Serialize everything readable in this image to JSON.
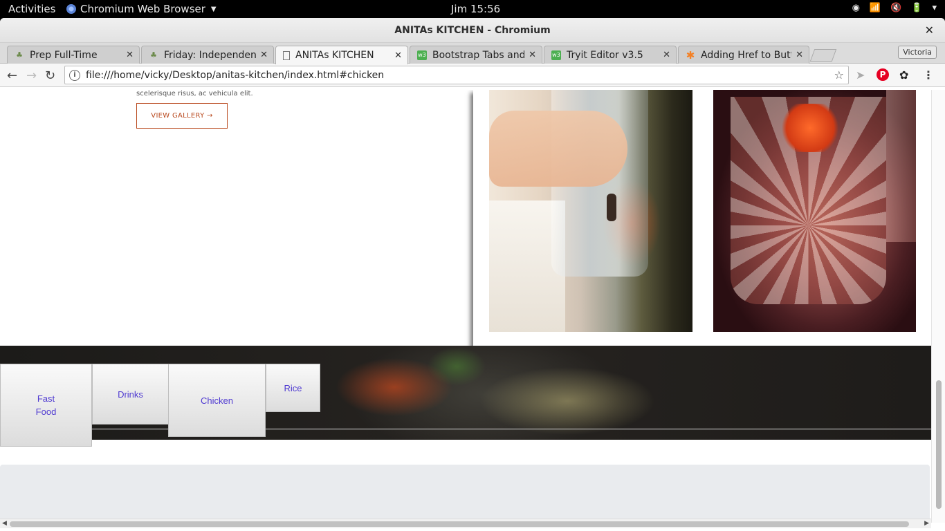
{
  "desktop": {
    "activities": "Activities",
    "app_menu": "Chromium Web Browser",
    "clock": "Jim 15:56"
  },
  "window": {
    "title": "ANITAs KITCHEN - Chromium",
    "close": "✕"
  },
  "tabs": [
    {
      "label": "Prep Full-Time",
      "icon": "tree-icon"
    },
    {
      "label": "Friday: Independent",
      "icon": "tree-icon"
    },
    {
      "label": "ANITAs KITCHEN",
      "icon": "page-icon",
      "active": true
    },
    {
      "label": "Bootstrap Tabs and P",
      "icon": "w3-icon"
    },
    {
      "label": "Tryit Editor v3.5",
      "icon": "w3-icon"
    },
    {
      "label": "Adding Href to Butto",
      "icon": "stackoverflow-icon"
    }
  ],
  "profile": "Victoria",
  "address_bar": {
    "url": "file:///home/vicky/Desktop/anitas-kitchen/index.html#chicken"
  },
  "page": {
    "snippet": "scelerisque risus, ac vehicula elit.",
    "gallery_button": "VIEW GALLERY →",
    "food_tabs": [
      "Fast\nFood",
      "Drinks",
      "Chicken",
      "Rice"
    ]
  },
  "colors": {
    "accent": "#b94a1f",
    "tab_text": "#4f3ad1",
    "footer_bg": "#e9ebee"
  }
}
